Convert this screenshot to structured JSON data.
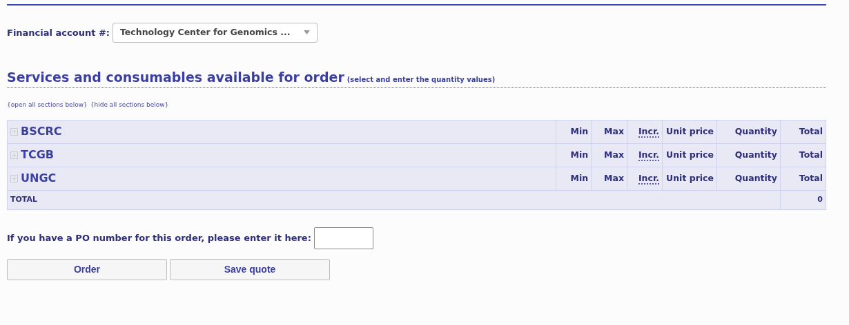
{
  "account": {
    "label": "Financial account #:",
    "value": "Technology Center for Genomics ..."
  },
  "heading": {
    "title": "Services and consumables available for order",
    "hint": "(select and enter the quantity values)"
  },
  "links": [
    "{open all sections below}",
    "{hide all sections below}"
  ],
  "table": {
    "sections": [
      {
        "name": "BSCRC",
        "expanded": false,
        "columns": [
          "Min",
          "Max",
          "Incr.",
          "Unit price",
          "Quantity",
          "Total"
        ]
      },
      {
        "name": "TCGB",
        "expanded": false,
        "columns": [
          "Min",
          "Max",
          "Incr.",
          "Unit price",
          "Quantity",
          "Total"
        ]
      },
      {
        "name": "UNGC",
        "expanded": false,
        "columns": [
          "Min",
          "Max",
          "Incr.",
          "Unit price",
          "Quantity",
          "Total"
        ]
      }
    ],
    "total": {
      "label": "TOTAL",
      "value": "0"
    }
  },
  "po": {
    "label": "If you have a PO number for this order, please enter it here:"
  },
  "buttons": [
    "Order",
    "Save quote"
  ]
}
